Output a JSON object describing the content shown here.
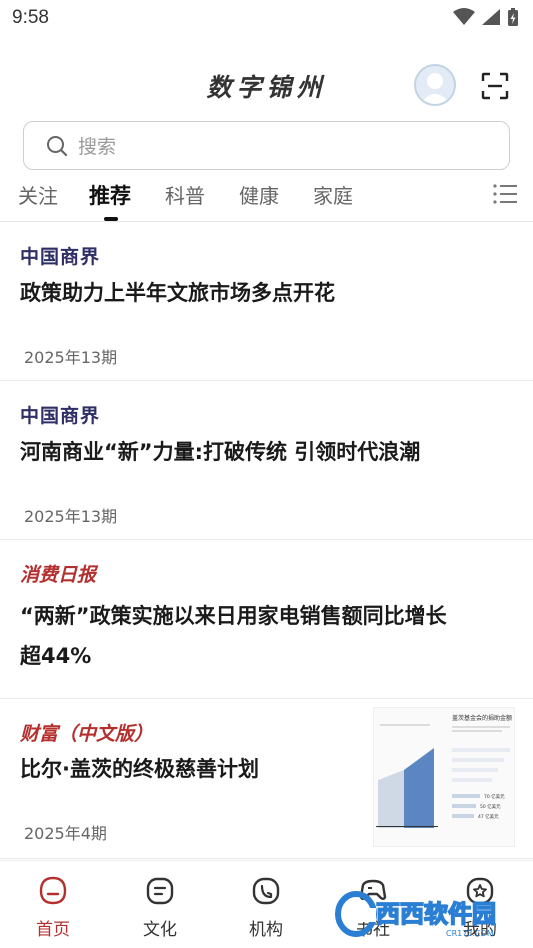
{
  "status_bar": {
    "time": "9:58"
  },
  "header": {
    "title": "数字锦州"
  },
  "search": {
    "placeholder": "搜索"
  },
  "tabs": [
    {
      "label": "关注",
      "active": false
    },
    {
      "label": "推荐",
      "active": true
    },
    {
      "label": "科普",
      "active": false
    },
    {
      "label": "健康",
      "active": false
    },
    {
      "label": "家庭",
      "active": false
    }
  ],
  "articles": [
    {
      "source": "中国商界",
      "title_lines": [
        "政策助力上半年文旅市场多点开花"
      ],
      "date": "2025年13期"
    },
    {
      "source": "中国商界",
      "title_lines": [
        "河南商业“新”力量:打破传统 引领时代浪潮"
      ],
      "date": "2025年13期"
    },
    {
      "source": "消费日报",
      "title_lines": [
        "“两新”政策实施以来日用家电销售额同比增长",
        "超44%"
      ],
      "date": ""
    },
    {
      "source": "财富（中文版）",
      "title_lines": [
        "比尔·盖茨的终极慈善计划"
      ],
      "date": "2025年4期",
      "thumb": {
        "caption": "盖茨基金会的捐助金额",
        "bar_labels": [
          "70 亿美元",
          "50 亿美元",
          "47 亿美元"
        ]
      }
    }
  ],
  "bottom_nav": [
    {
      "label": "首页",
      "icon": "home-icon",
      "active": true
    },
    {
      "label": "文化",
      "icon": "culture-icon",
      "active": false
    },
    {
      "label": "机构",
      "icon": "institution-icon",
      "active": false
    },
    {
      "label": "书社",
      "icon": "gamepad-icon",
      "active": false
    },
    {
      "label": "我的",
      "icon": "star-badge-icon",
      "active": false
    }
  ],
  "watermark": {
    "text": "西西软件园",
    "sub": "CR173.COM"
  },
  "colors": {
    "accent": "#b4302f",
    "navy": "#2f2f66"
  }
}
